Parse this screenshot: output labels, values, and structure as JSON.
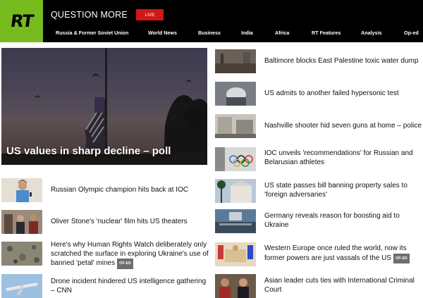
{
  "header": {
    "logo": "RT",
    "tagline": "QUESTION MORE",
    "live_label": "LIVE",
    "nav": [
      "Russia & Former Soviet Union",
      "World News",
      "Business",
      "India",
      "Africa",
      "RT Features",
      "Analysis",
      "Op-ed"
    ]
  },
  "hero": {
    "title": "US values in sharp decline – poll"
  },
  "left_stories": [
    {
      "title": "Russian Olympic champion hits back at IOC",
      "oped": ""
    },
    {
      "title": "Oliver Stone's 'nuclear' film hits US theaters",
      "oped": ""
    },
    {
      "title": "Here's why Human Rights Watch deliberately only scratched the surface in exploring Ukraine's use of banned 'petal' mines",
      "oped": "OP-ED"
    },
    {
      "title": "Drone incident hindered US intelligence gathering – CNN",
      "oped": ""
    }
  ],
  "right_stories": [
    {
      "title": "Baltimore blocks East Palestine toxic water dump",
      "oped": ""
    },
    {
      "title": "US admits to another failed hypersonic test",
      "oped": ""
    },
    {
      "title": "Nashville shooter hid seven guns at home – police",
      "oped": ""
    },
    {
      "title": "IOC unveils 'recommendations' for Russian and Belarusian athletes",
      "oped": ""
    },
    {
      "title": "US state passes bill banning property sales to 'foreign adversaries'",
      "oped": ""
    },
    {
      "title": "Germany reveals reason for boosting aid to Ukraine",
      "oped": ""
    },
    {
      "title": "Western Europe once ruled the world, now its former powers are just vassals of the US",
      "oped": "OP-ED"
    },
    {
      "title": "Asian leader cuts ties with International Criminal Court",
      "oped": ""
    }
  ],
  "colors": {
    "brand_green": "#77bc1f",
    "live_red": "#d01818",
    "header_bg": "#000000",
    "oped_badge": "#6d6d6d"
  }
}
